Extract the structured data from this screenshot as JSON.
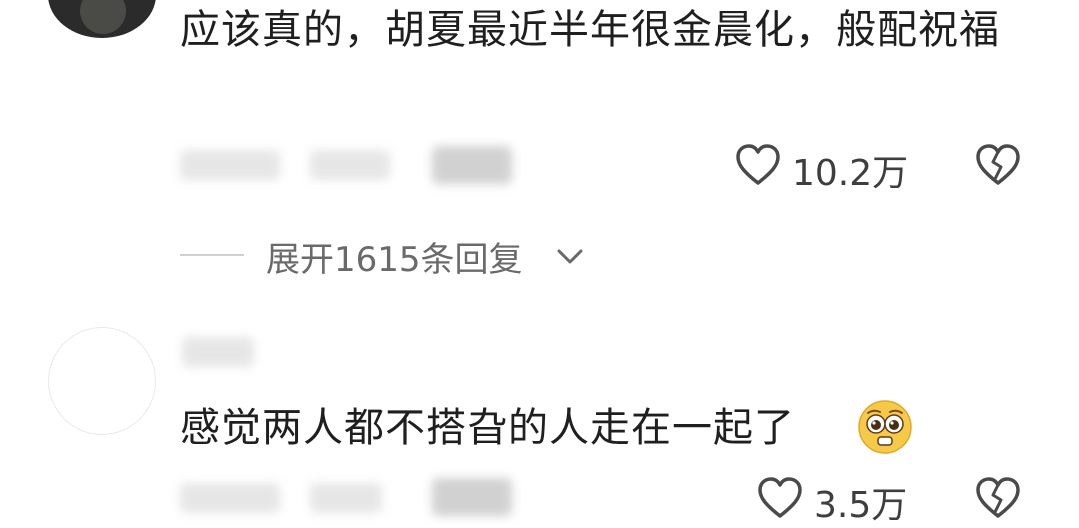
{
  "comments": [
    {
      "text": "应该真的，胡夏最近半年很金晨化，般配祝福",
      "likes": "10.2万",
      "expand_replies": "展开1615条回复"
    },
    {
      "text": "感觉两人都不搭旮的人走在一起了",
      "emoji": "pleading-face-emoji",
      "likes": "3.5万"
    }
  ],
  "icons": {
    "like": "heart-outline-icon",
    "dislike": "broken-heart-icon",
    "expand": "chevron-down-icon"
  },
  "colors": {
    "text": "#1f1f1f",
    "secondary": "#6a6a6a",
    "blurred_meta": "#c9c9c9"
  }
}
